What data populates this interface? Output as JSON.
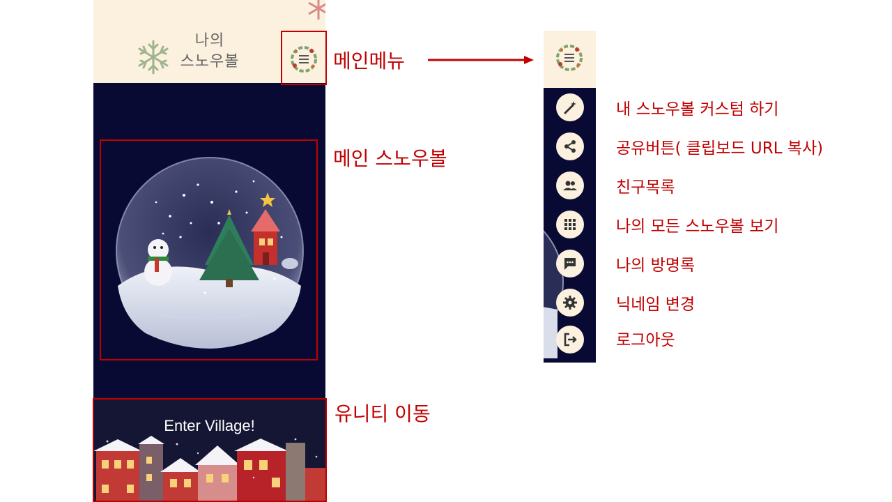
{
  "app": {
    "title_line1": "나의",
    "title_line2": "스노우볼",
    "village_button": "Enter Village!"
  },
  "annotations": {
    "main_menu": "메인메뉴",
    "main_snowball": "메인 스노우볼",
    "unity_move": "유니티 이동"
  },
  "menu": {
    "items": [
      {
        "label": "내 스노우볼 커스텀 하기",
        "icon": "magic-wand-icon"
      },
      {
        "label": "공유버튼( 클립보드 URL 복사)",
        "icon": "share-icon"
      },
      {
        "label": "친구목록",
        "icon": "people-icon"
      },
      {
        "label": "나의 모든 스노우볼 보기",
        "icon": "grid-icon"
      },
      {
        "label": "나의 방명록",
        "icon": "chat-icon"
      },
      {
        "label": "닉네임 변경",
        "icon": "gear-icon"
      },
      {
        "label": "로그아웃",
        "icon": "logout-icon"
      }
    ]
  },
  "colors": {
    "accent_red": "#c00000",
    "header_cream": "#fcf1df",
    "navy": "#090a33"
  }
}
